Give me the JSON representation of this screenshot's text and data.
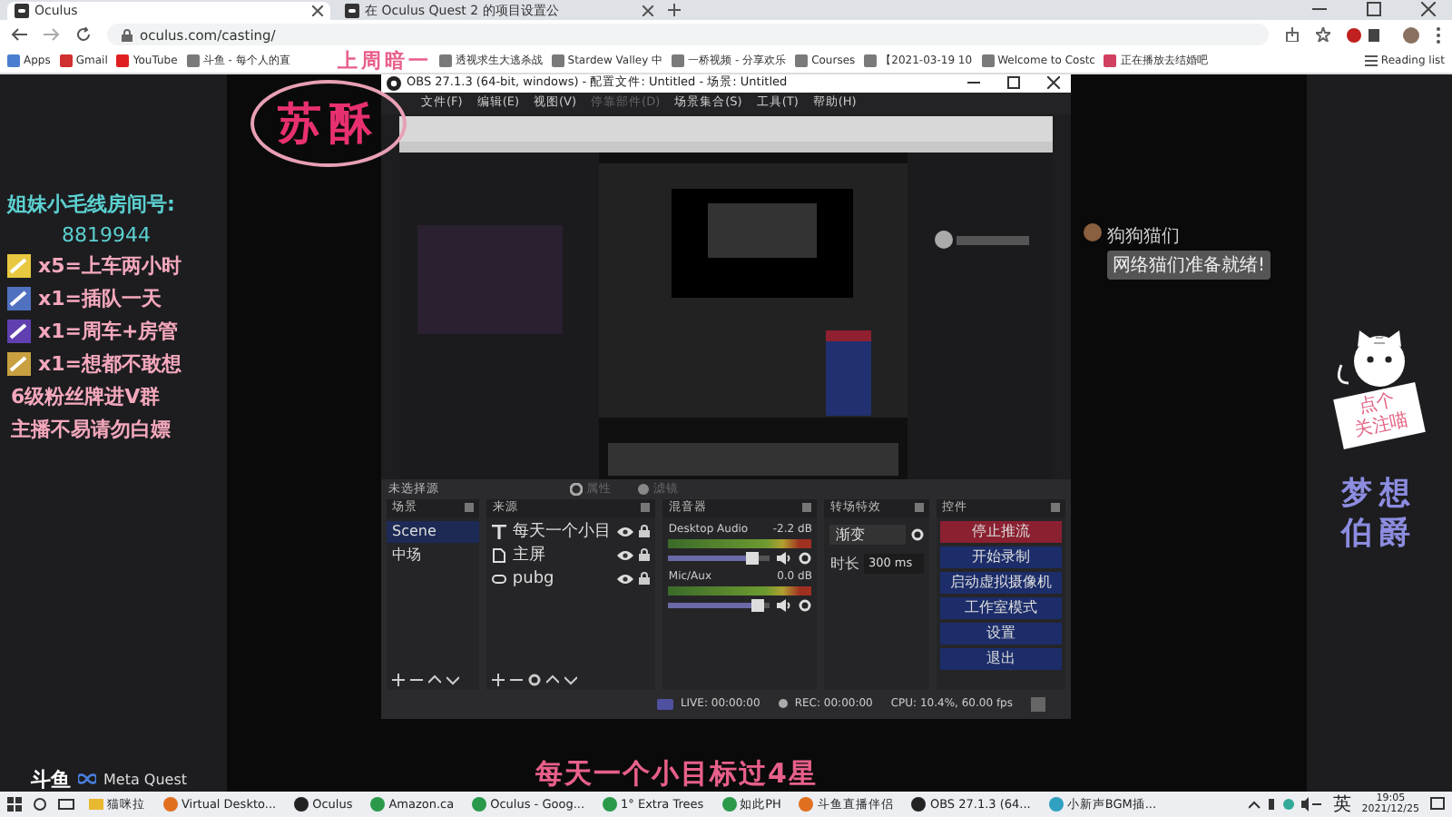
{
  "browser": {
    "tabs": [
      {
        "title": "Oculus",
        "selected": true
      },
      {
        "title": "在 Oculus Quest 2 的项目设置公",
        "selected": false
      }
    ],
    "url": "oculus.com/casting/",
    "bookmarks": [
      {
        "kind": "apps",
        "label": "Apps"
      },
      {
        "kind": "mail",
        "label": "Gmail"
      },
      {
        "kind": "video",
        "label": "YouTube"
      },
      {
        "kind": "site",
        "label": "斗鱼 - 每个人的直"
      },
      {
        "kind": "site",
        "label": "透视求生大逃杀战"
      },
      {
        "kind": "site",
        "label": "Stardew Valley 中"
      },
      {
        "kind": "site",
        "label": "一桥视频 - 分享欢乐"
      },
      {
        "kind": "site",
        "label": "Courses"
      },
      {
        "kind": "site",
        "label": "【2021-03-19 10"
      },
      {
        "kind": "site",
        "label": "Welcome to Costc"
      },
      {
        "kind": "pin",
        "label": "正在播放去结婚吧"
      }
    ],
    "reading_list": "Reading list"
  },
  "captions": {
    "top": "上周暗一",
    "name": "苏酥",
    "bottom": "每天一个小目标过4星"
  },
  "left_panel": {
    "title": "姐妹小毛线房间号:",
    "room_number": "8819944",
    "gifts": [
      {
        "color": "#e8c840",
        "text": "x5=上车两小时"
      },
      {
        "color": "#5070c0",
        "text": "x1=插队一天"
      },
      {
        "color": "#6040b0",
        "text": "x1=周车+房管"
      },
      {
        "color": "#c8a040",
        "text": "x1=想都不敢想"
      }
    ],
    "notes": [
      "6级粉丝牌进V群",
      "主播不易请勿白嫖"
    ]
  },
  "obs": {
    "title": "OBS 27.1.3 (64-bit, windows) - 配置文件: Untitled - 场景: Untitled",
    "menu": [
      {
        "label": "文件(F)",
        "disabled": false
      },
      {
        "label": "编辑(E)",
        "disabled": false
      },
      {
        "label": "视图(V)",
        "disabled": false
      },
      {
        "label": "停靠部件(D)",
        "disabled": true
      },
      {
        "label": "场景集合(S)",
        "disabled": false
      },
      {
        "label": "工具(T)",
        "disabled": false
      },
      {
        "label": "帮助(H)",
        "disabled": false
      }
    ],
    "no_source": "未选择源",
    "source_tools": [
      {
        "kind": "properties",
        "label": "属性",
        "disabled": true
      },
      {
        "kind": "filters",
        "label": "滤镜",
        "disabled": true
      }
    ],
    "scenes": {
      "title": "场景",
      "items": [
        {
          "label": "Scene",
          "selected": true
        },
        {
          "label": "中场",
          "selected": false
        }
      ]
    },
    "sources": {
      "title": "来源",
      "items": [
        {
          "kind": "text",
          "label": "每天一个小目"
        },
        {
          "kind": "image",
          "label": "主屏"
        },
        {
          "kind": "capture",
          "label": "pubg"
        }
      ]
    },
    "mixer": {
      "title": "混音器",
      "channels": [
        {
          "name": "Desktop Audio",
          "reading": "-2.2 dB",
          "level": 0.82
        },
        {
          "name": "Mic/Aux",
          "reading": "0.0 dB",
          "level": 0.86
        }
      ]
    },
    "transitions": {
      "title": "转场特效",
      "type": "渐变",
      "duration_label": "时长",
      "duration": "300 ms"
    },
    "controls": {
      "title": "控件",
      "buttons": [
        {
          "kind": "stop",
          "label": "停止推流"
        },
        {
          "kind": "normal",
          "label": "开始录制"
        },
        {
          "kind": "normal",
          "label": "启动虚拟摄像机"
        },
        {
          "kind": "normal",
          "label": "工作室模式"
        },
        {
          "kind": "normal",
          "label": "设置"
        },
        {
          "kind": "normal",
          "label": "退出"
        }
      ]
    },
    "status": {
      "live": "LIVE: 00:00:00",
      "rec": "REC: 00:00:00",
      "cpu": "CPU: 10.4%, 60.00 fps"
    }
  },
  "chat": {
    "user": "狗狗猫们",
    "message": "网络猫们准备就绪!"
  },
  "right_panel": {
    "sign_lines": [
      "点个",
      "关注喵"
    ],
    "name_lines": [
      "梦想",
      "伯爵"
    ]
  },
  "footer": {
    "logo": "斗鱼",
    "brand": "Meta Quest"
  },
  "taskbar": {
    "items": [
      {
        "kind": "folder",
        "label": "猫咪拉"
      },
      {
        "kind": "app",
        "label": "Virtual Deskto..."
      },
      {
        "kind": "oculus",
        "label": "Oculus"
      },
      {
        "kind": "browser",
        "label": "Amazon.ca"
      },
      {
        "kind": "browser",
        "label": "Oculus - Goog..."
      },
      {
        "kind": "browser",
        "label": "1° Extra Trees"
      },
      {
        "kind": "browser",
        "label": "如此PH"
      },
      {
        "kind": "app",
        "label": "斗鱼直播伴侣"
      },
      {
        "kind": "obs",
        "label": "OBS 27.1.3 (64..."
      },
      {
        "kind": "music",
        "label": "小新声BGM插..."
      }
    ],
    "ime": "英",
    "time": "19:05",
    "date": "2021/12/25"
  }
}
